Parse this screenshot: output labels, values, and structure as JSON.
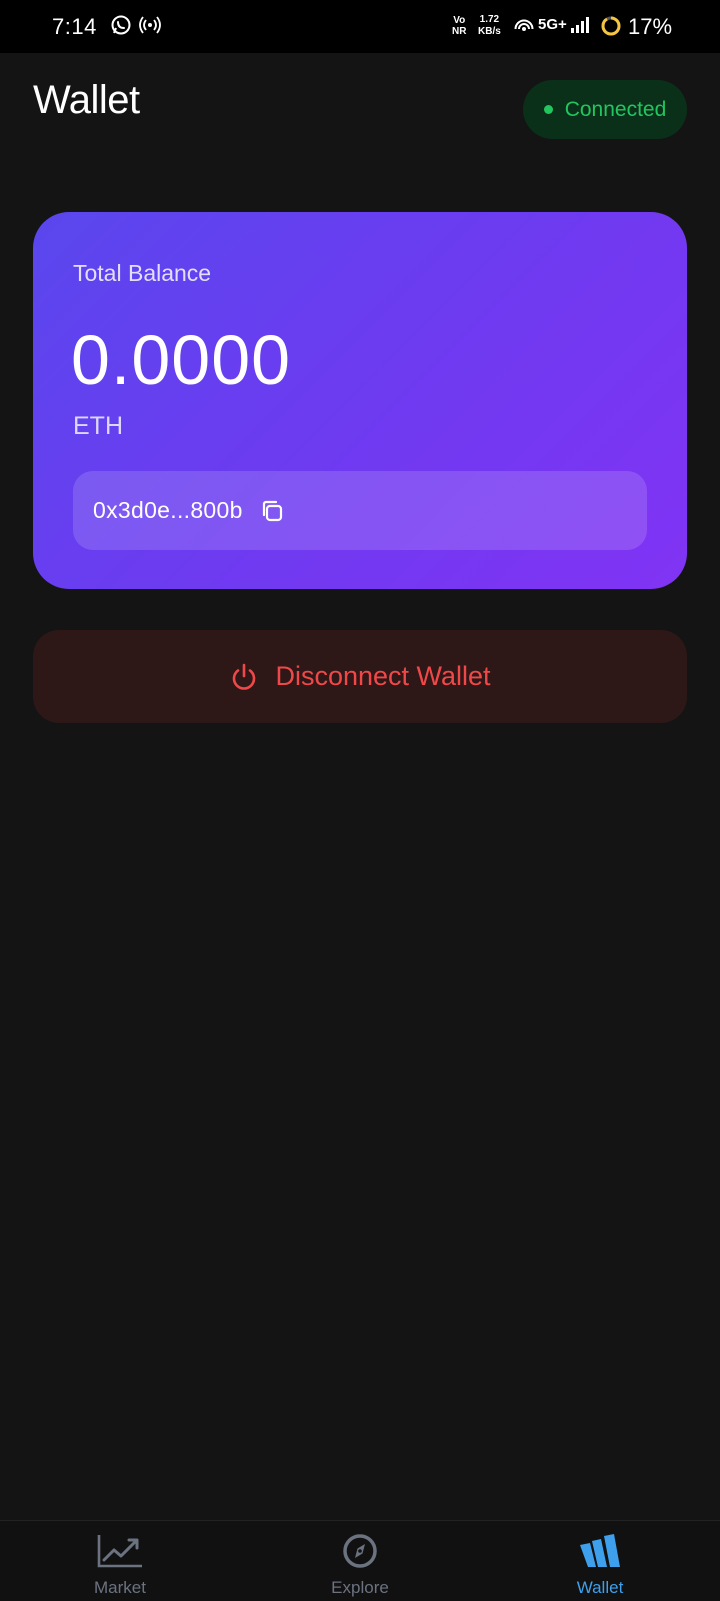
{
  "status_bar": {
    "time": "7:14",
    "network_top": "Vo",
    "network_bottom": "NR",
    "speed_value": "1.72",
    "speed_unit": "KB/s",
    "signal_label": "5G+",
    "battery_percent": "17%",
    "icons": [
      "whatsapp-icon",
      "broadcast-icon",
      "hotspot-icon",
      "signal-bars-icon",
      "battery-ring-icon"
    ]
  },
  "header": {
    "title": "Wallet",
    "connection_status": "Connected",
    "connection_color": "#22c55e"
  },
  "balance_card": {
    "label": "Total Balance",
    "amount": "0.0000",
    "unit": "ETH",
    "address": "0x3d0e...800b",
    "copy_icon": "copy-icon",
    "gradient_start": "#5a47ee",
    "gradient_end": "#8133f4"
  },
  "disconnect": {
    "label": "Disconnect Wallet",
    "icon": "power-icon",
    "color": "#f04848"
  },
  "bottom_nav": {
    "active_color": "#3ea0ec",
    "items": [
      {
        "label": "Market",
        "icon": "chart-trend-icon",
        "active": false
      },
      {
        "label": "Explore",
        "icon": "compass-icon",
        "active": false
      },
      {
        "label": "Wallet",
        "icon": "wallet-logo-icon",
        "active": true
      }
    ]
  }
}
